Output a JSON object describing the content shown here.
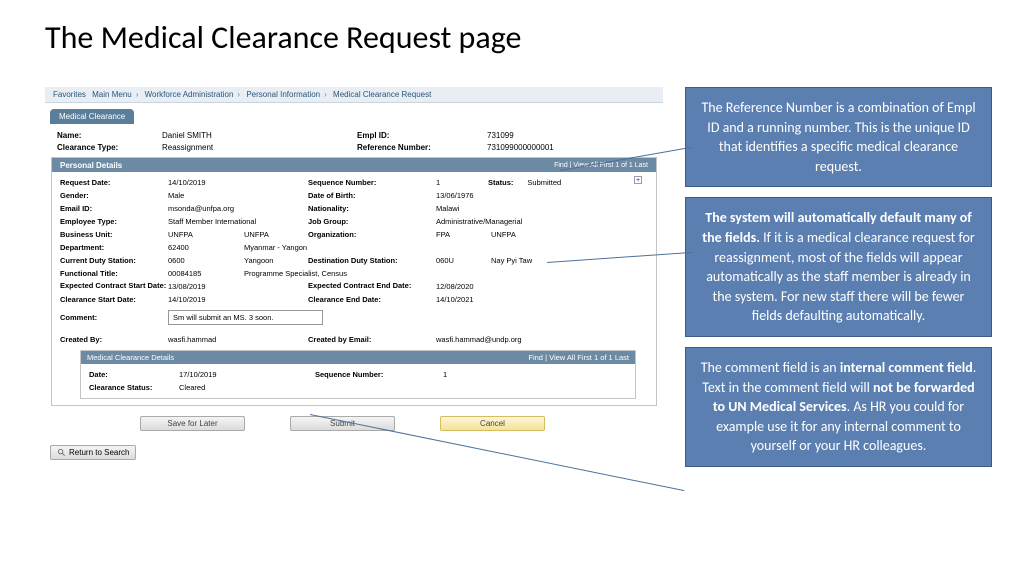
{
  "slide_title": "The Medical Clearance Request page",
  "breadcrumb": {
    "favorites": "Favorites",
    "main": "Main Menu",
    "l1": "Workforce Administration",
    "l2": "Personal Information",
    "l3": "Medical Clearance Request"
  },
  "tab": "Medical Clearance",
  "header": {
    "name_lbl": "Name:",
    "name": "Daniel SMITH",
    "empl_id_lbl": "Empl ID:",
    "empl_id": "731099",
    "clearance_type_lbl": "Clearance Type:",
    "clearance_type": "Reassignment",
    "ref_lbl": "Reference Number:",
    "ref": "731099000000001"
  },
  "personal": {
    "title": "Personal Details",
    "pager": "Find | View All   First 1 of 1  Last",
    "req_date_lbl": "Request Date:",
    "req_date": "14/10/2019",
    "seq_lbl": "Sequence Number:",
    "seq": "1",
    "status_lbl": "Status:",
    "status": "Submitted",
    "gender_lbl": "Gender:",
    "gender": "Male",
    "dob_lbl": "Date of Birth:",
    "dob": "13/06/1976",
    "email_lbl": "Email ID:",
    "email": "msonda@unfpa.org",
    "nat_lbl": "Nationality:",
    "nat": "Malawi",
    "emp_type_lbl": "Employee Type:",
    "emp_type": "Staff Member International",
    "job_lbl": "Job Group:",
    "job": "Administrative/Managerial",
    "bu_lbl": "Business Unit:",
    "bu_code": "UNFPA",
    "bu": "UNFPA",
    "org_lbl": "Organization:",
    "org_code": "FPA",
    "org": "UNFPA",
    "dept_lbl": "Department:",
    "dept_code": "62400",
    "dept": "Myanmar - Yangon",
    "duty_lbl": "Current Duty Station:",
    "duty_code": "0600",
    "duty": "Yangoon",
    "dest_lbl": "Destination Duty Station:",
    "dest_code": "060U",
    "dest": "Nay Pyi Taw",
    "func_lbl": "Functional Title:",
    "func_code": "00084185",
    "func": "Programme Specialist, Census",
    "c_start_lbl": "Expected Contract Start Date:",
    "c_start": "13/08/2019",
    "c_end_lbl": "Expected Contract End Date:",
    "c_end": "12/08/2020",
    "cl_start_lbl": "Clearance Start Date:",
    "cl_start": "14/10/2019",
    "cl_end_lbl": "Clearance End Date:",
    "cl_end": "14/10/2021",
    "comment_lbl": "Comment:",
    "comment": "Sm will submit an MS. 3 soon.",
    "created_lbl": "Created By:",
    "created": "wasfi.hammad",
    "created_email_lbl": "Created by Email:",
    "created_email": "wasfi.hammad@undp.org"
  },
  "mcd": {
    "title": "Medical Clearance Details",
    "pager": "Find | View All   First 1 of 1  Last",
    "date_lbl": "Date:",
    "date": "17/10/2019",
    "seq_lbl": "Sequence Number:",
    "seq": "1",
    "status_lbl": "Clearance Status:",
    "status": "Cleared"
  },
  "buttons": {
    "save": "Save for Later",
    "submit": "Submit",
    "cancel": "Cancel",
    "return": "Return to Search"
  },
  "callouts": {
    "c1": "The Reference Number is a combination of Empl ID and a running number.  This is the unique ID that identifies a specific medical clearance request.",
    "c2a": "The system will automatically default many of the fields.",
    "c2b": " If it is a medical clearance request for reassignment, most of the fields will appear automatically as the staff member is already in the system. For new staff there will be fewer fields defaulting automatically.",
    "c3a": "The comment field is an ",
    "c3b": "internal comment field",
    "c3c": ". Text in the comment field will ",
    "c3d": "not be forwarded to UN Medical Services",
    "c3e": ". As HR you could for example use it for any internal comment to yourself or your HR colleagues."
  }
}
